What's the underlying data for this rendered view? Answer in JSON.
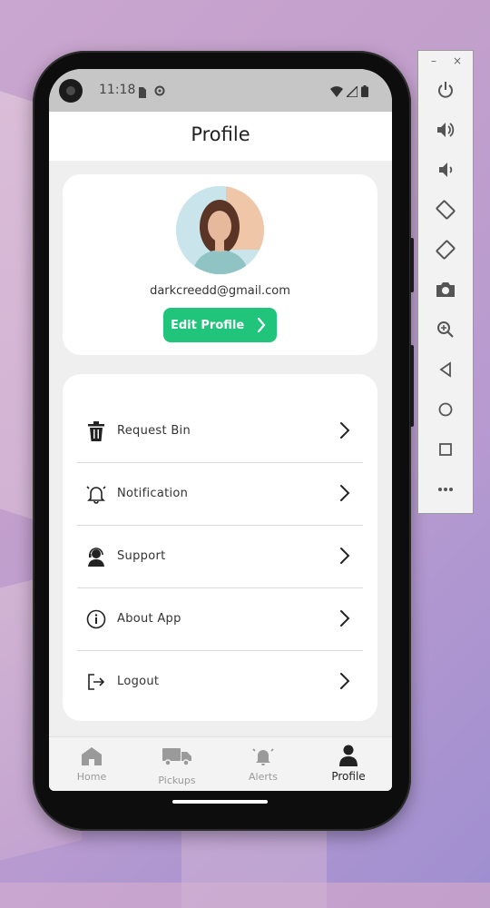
{
  "status_bar": {
    "time": "11:18"
  },
  "app_bar": {
    "title": "Profile"
  },
  "profile": {
    "email": "darkcreedd@gmail.com",
    "edit_label": "Edit Profile"
  },
  "menu": {
    "items": [
      {
        "label": "Request Bin",
        "icon": "trash-bin-icon"
      },
      {
        "label": "Notification",
        "icon": "bell-icon"
      },
      {
        "label": "Support",
        "icon": "support-agent-icon"
      },
      {
        "label": "About App",
        "icon": "info-icon"
      },
      {
        "label": "Logout",
        "icon": "logout-icon"
      }
    ]
  },
  "bottom_nav": {
    "items": [
      {
        "label": "Home",
        "icon": "home-icon",
        "active": false
      },
      {
        "label": "Pickups",
        "icon": "truck-icon",
        "active": false
      },
      {
        "label": "Alerts",
        "icon": "alarm-bell-icon",
        "active": false
      },
      {
        "label": "Profile",
        "icon": "person-icon",
        "active": true
      }
    ]
  },
  "emulator_toolbar": {
    "buttons": [
      "power-icon",
      "volume-up-icon",
      "volume-down-icon",
      "rotate-left-icon",
      "rotate-right-icon",
      "camera-icon",
      "zoom-icon",
      "back-icon",
      "home-circle-icon",
      "overview-icon",
      "more-icon"
    ],
    "minimize": "–",
    "close": "×"
  },
  "colors": {
    "accent": "#21c47b",
    "screen_bg": "#efefef",
    "status_bar": "#c6c6c6"
  }
}
